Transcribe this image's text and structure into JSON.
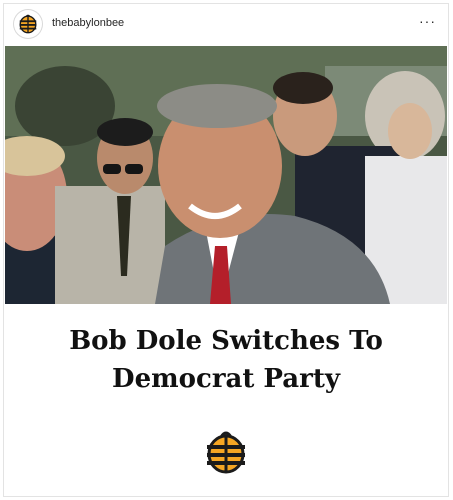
{
  "post": {
    "username": "thebabylonbee",
    "more_label": "···",
    "headline_line1": "Bob Dole Switches To",
    "headline_line2": "Democrat Party"
  },
  "colors": {
    "brand_orange": "#f5a623",
    "brand_dark": "#1b1b1b",
    "text": "#111111"
  },
  "icons": {
    "avatar": "babylon-bee-logo-icon",
    "more": "more-options-icon",
    "footer_logo": "babylon-bee-logo-icon"
  },
  "photo": {
    "alt": "Smiling man in grey suit and red tie among a crowd"
  }
}
